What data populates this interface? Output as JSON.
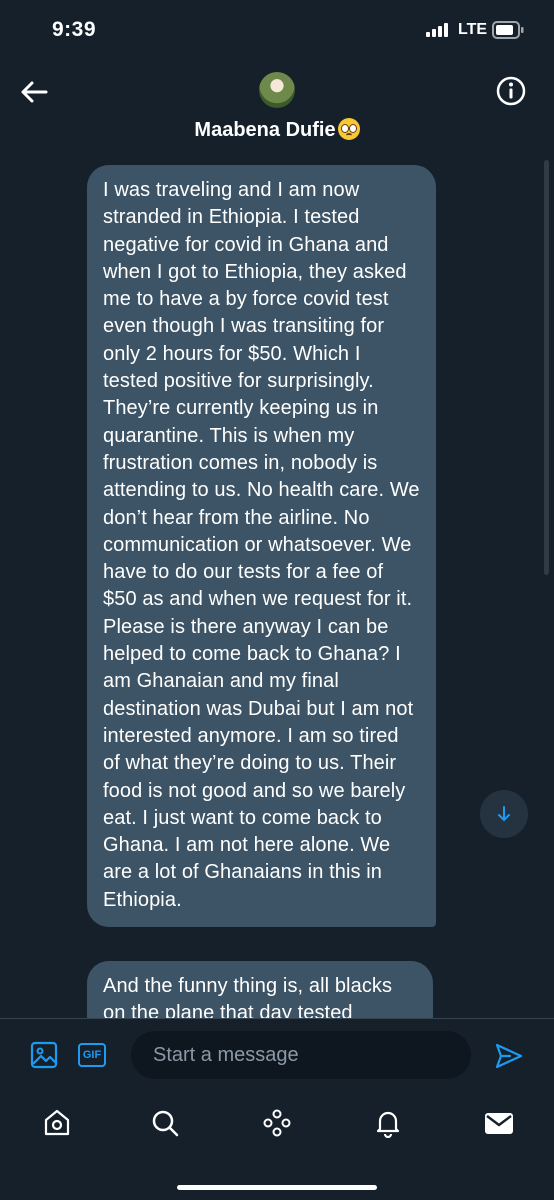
{
  "status_bar": {
    "time": "9:39",
    "network": "LTE"
  },
  "header": {
    "contact_name": "Maabena Dufie"
  },
  "messages": [
    {
      "text": "I was traveling and I am now stranded in Ethiopia. I tested negative for covid in Ghana and when I got to Ethiopia, they asked me to have a by force covid test even though I was transiting for only 2 hours for $50. Which I tested positive for surprisingly. They’re currently keeping us in quarantine. This is when my frustration comes in, nobody is attending to us. No health care. We don’t hear from the airline. No communication or whatsoever. We have to do our tests for a fee of $50 as and when we request for it.\nPlease is there anyway I can be helped to come back to Ghana? I am Ghanaian and my final destination was Dubai but I am not interested anymore. I am so tired of what they’re doing to us. Their food is not good and so we barely eat. I just want to come back to Ghana. I am not here alone. We are a lot of Ghanaians in this in Ethiopia."
    },
    {
      "text": "And the funny thing is, all blacks on the plane that day tested"
    }
  ],
  "composer": {
    "placeholder": "Start a message",
    "gif_label": "GIF"
  },
  "icons": {
    "back": "arrow-left-icon",
    "info": "info-icon",
    "media": "image-icon",
    "gif": "gif-icon",
    "send": "send-icon",
    "scroll_down": "arrow-down-icon",
    "tabs": [
      "home-icon",
      "search-icon",
      "spaces-icon",
      "notifications-icon",
      "messages-icon"
    ]
  },
  "colors": {
    "background": "#15202b",
    "bubble": "#3d5466",
    "accent": "#1d9bf0"
  }
}
